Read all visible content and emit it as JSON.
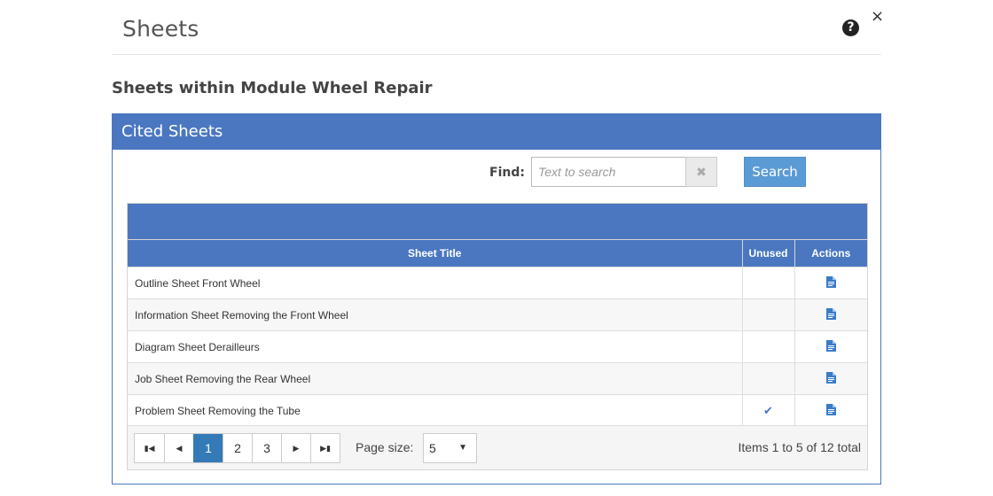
{
  "modal": {
    "title": "Sheets",
    "help_icon": "question-circle-icon",
    "close_icon": "close-icon"
  },
  "subtitle": "Sheets within Module Wheel Repair",
  "panel": {
    "heading": "Cited Sheets"
  },
  "search": {
    "find_label": "Find:",
    "placeholder": "Text to search",
    "value": "",
    "clear_symbol": "✖",
    "button_label": "Search"
  },
  "table": {
    "columns": [
      "Sheet Title",
      "Unused",
      "Actions"
    ],
    "rows": [
      {
        "title": "Outline Sheet Front Wheel",
        "unused": false
      },
      {
        "title": "Information Sheet Removing the Front Wheel",
        "unused": false
      },
      {
        "title": "Diagram Sheet Derailleurs",
        "unused": false
      },
      {
        "title": "Job Sheet Removing the Rear Wheel",
        "unused": false
      },
      {
        "title": "Problem Sheet Removing the Tube",
        "unused": true
      }
    ]
  },
  "pager": {
    "first": "⏮",
    "prev": "◀",
    "next": "▶",
    "last": "⏭",
    "pages": [
      "1",
      "2",
      "3"
    ],
    "current_page": "1",
    "page_size_label": "Page size:",
    "page_size": "5",
    "items_info": "Items 1 to 5 of 12 total"
  },
  "colors": {
    "primary": "#4a77c0",
    "active_page": "#337ab7",
    "search_button": "#5b9bd5"
  }
}
